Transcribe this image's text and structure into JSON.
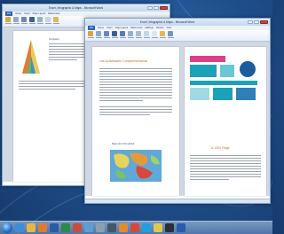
{
  "windows": {
    "back": {
      "title": "Excel, Infographic & Maps - Microsoft Word",
      "tabs": [
        "File",
        "Home",
        "Insert",
        "Page Layout",
        "References",
        "Mailings",
        "Review",
        "View"
      ]
    },
    "front": {
      "title": "Excel, Infographic & Maps - Microsoft Word",
      "tabs": [
        "File",
        "Home",
        "Insert",
        "Page Layout",
        "References",
        "Mailings",
        "Review",
        "View"
      ]
    }
  },
  "documents": {
    "back_page": {
      "paragraph_label": "Incubation"
    },
    "front_left_page": {
      "heading": "Las Actividades Complementarias",
      "map_caption": "Mapa del clima global"
    },
    "front_right_page": {
      "heading": "A 1000 Page"
    }
  },
  "colors": {
    "desktop": "#1f4f8c",
    "accent_orange": "#c0722b",
    "infographic_teal": "#1aa3b8"
  },
  "taskbar": {
    "icons": [
      "start-orb",
      "ie-icon",
      "folder-icon",
      "media-icon",
      "word-icon",
      "excel-icon",
      "paint-icon",
      "mail-icon",
      "gear-icon",
      "camera-icon",
      "firefox-icon",
      "chrome-icon",
      "skype-icon",
      "notes-icon",
      "terminal-icon",
      "word-icon"
    ]
  }
}
